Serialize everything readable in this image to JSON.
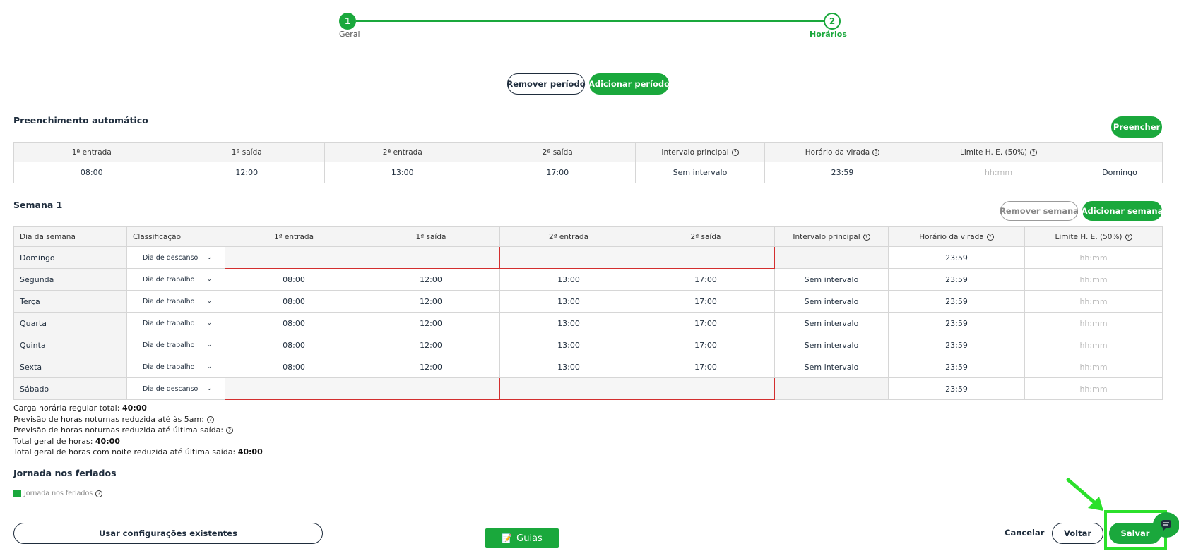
{
  "stepper": {
    "step1_number": "1",
    "step1_label": "Geral",
    "step2_number": "2",
    "step2_label": "Horários"
  },
  "period_buttons": {
    "remove": "Remover período",
    "add": "Adicionar período"
  },
  "auto_fill": {
    "title": "Preenchimento automático",
    "fill_button": "Preencher",
    "headers": [
      "1ª entrada",
      "1ª saída",
      "2ª entrada",
      "2ª saída",
      "Intervalo principal",
      "Horário da virada",
      "Limite H. E. (50%)"
    ],
    "values": {
      "entrada1": "08:00",
      "saida1": "12:00",
      "entrada2": "13:00",
      "saida2": "17:00",
      "intervalo": "Sem intervalo",
      "virada": "23:59",
      "limite_placeholder": "hh:mm",
      "dia": "Domingo"
    }
  },
  "week": {
    "title": "Semana 1",
    "remove_button": "Remover semana",
    "add_button": "Adicionar semana",
    "headers": {
      "day": "Dia da semana",
      "classification": "Classificação",
      "entrada1": "1ª entrada",
      "saida1": "1ª saída",
      "entrada2": "2ª entrada",
      "saida2": "2ª saída",
      "intervalo": "Intervalo principal",
      "virada": "Horário da virada",
      "limite": "Limite H. E. (50%)"
    },
    "rows": [
      {
        "day": "Domingo",
        "classification": "Dia de descanso",
        "e1": "",
        "s1": "",
        "e2": "",
        "s2": "",
        "intervalo": "",
        "virada": "23:59",
        "limite": "hh:mm"
      },
      {
        "day": "Segunda",
        "classification": "Dia de trabalho",
        "e1": "08:00",
        "s1": "12:00",
        "e2": "13:00",
        "s2": "17:00",
        "intervalo": "Sem intervalo",
        "virada": "23:59",
        "limite": "hh:mm"
      },
      {
        "day": "Terça",
        "classification": "Dia de trabalho",
        "e1": "08:00",
        "s1": "12:00",
        "e2": "13:00",
        "s2": "17:00",
        "intervalo": "Sem intervalo",
        "virada": "23:59",
        "limite": "hh:mm"
      },
      {
        "day": "Quarta",
        "classification": "Dia de trabalho",
        "e1": "08:00",
        "s1": "12:00",
        "e2": "13:00",
        "s2": "17:00",
        "intervalo": "Sem intervalo",
        "virada": "23:59",
        "limite": "hh:mm"
      },
      {
        "day": "Quinta",
        "classification": "Dia de trabalho",
        "e1": "08:00",
        "s1": "12:00",
        "e2": "13:00",
        "s2": "17:00",
        "intervalo": "Sem intervalo",
        "virada": "23:59",
        "limite": "hh:mm"
      },
      {
        "day": "Sexta",
        "classification": "Dia de trabalho",
        "e1": "08:00",
        "s1": "12:00",
        "e2": "13:00",
        "s2": "17:00",
        "intervalo": "Sem intervalo",
        "virada": "23:59",
        "limite": "hh:mm"
      },
      {
        "day": "Sábado",
        "classification": "Dia de descanso",
        "e1": "",
        "s1": "",
        "e2": "",
        "s2": "",
        "intervalo": "",
        "virada": "23:59",
        "limite": "hh:mm"
      }
    ]
  },
  "summary": {
    "regular_label": "Carga horária regular total: ",
    "regular_value": "40:00",
    "night5_label": "Previsão de horas noturnas reduzida até às 5am:",
    "night_last_label": "Previsão de horas noturnas reduzida até última saída:",
    "total_label": "Total geral de horas: ",
    "total_value": "40:00",
    "total_night_label": "Total geral de horas com noite reduzida até última saída: ",
    "total_night_value": "40:00"
  },
  "holidays": {
    "title": "Jornada nos feriados",
    "checkbox_label": "Jornada nos feriados"
  },
  "footer": {
    "use_existing": "Usar configurações existentes",
    "guias": "Guias",
    "cancel": "Cancelar",
    "back": "Voltar",
    "save": "Salvar"
  },
  "colors": {
    "accent": "#1aa83c",
    "error": "#d32f2f",
    "highlight": "#2be02b"
  }
}
